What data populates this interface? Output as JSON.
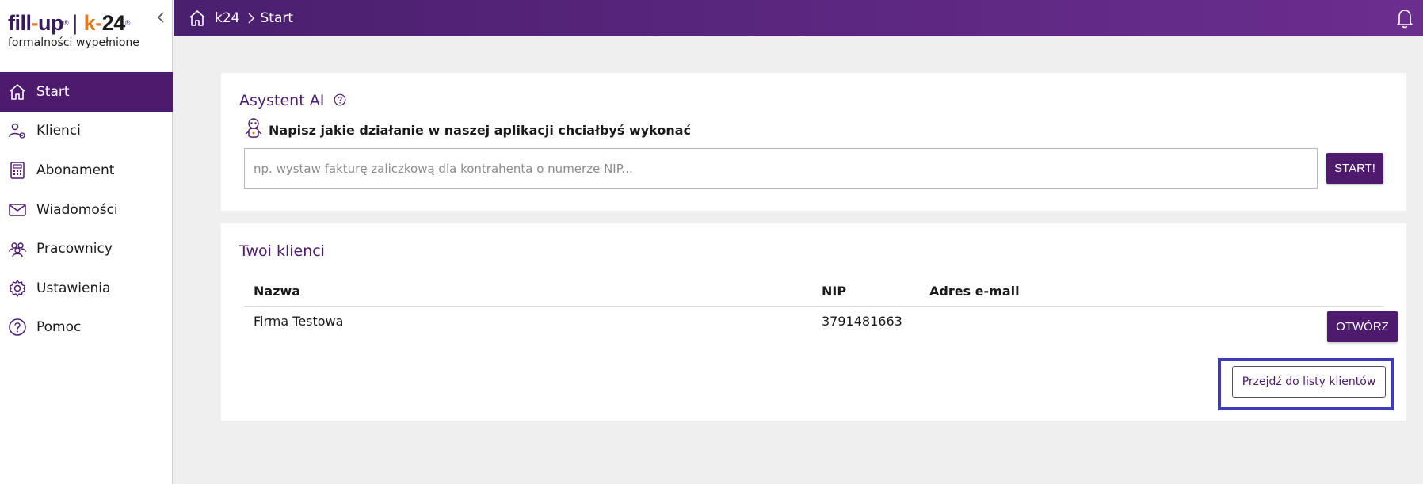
{
  "logo": {
    "fill": "fill",
    "dash1": "-",
    "up": "up",
    "reg1": "®",
    "sep": "|",
    "k": "k",
    "dash2": "-",
    "num": "24",
    "reg2": "®",
    "tagline": "formalności wypełnione"
  },
  "sidebar": {
    "items": [
      {
        "label": "Start",
        "icon": "home-icon",
        "active": true
      },
      {
        "label": "Klienci",
        "icon": "clients-icon"
      },
      {
        "label": "Abonament",
        "icon": "calculator-icon"
      },
      {
        "label": "Wiadomości",
        "icon": "mail-icon"
      },
      {
        "label": "Pracownicy",
        "icon": "team-icon"
      },
      {
        "label": "Ustawienia",
        "icon": "gear-icon"
      },
      {
        "label": "Pomoc",
        "icon": "help-icon"
      }
    ]
  },
  "topbar": {
    "breadcrumb": [
      "k24",
      "Start"
    ]
  },
  "ai": {
    "title": "Asystent AI",
    "prompt": "Napisz jakie działanie w naszej aplikacji chciałbyś wykonać",
    "placeholder": "np. wystaw fakturę zaliczkową dla kontrahenta o numerze NIP...",
    "value": "",
    "start_label": "START!"
  },
  "clients": {
    "title": "Twoi klienci",
    "columns": [
      "Nazwa",
      "NIP",
      "Adres e-mail"
    ],
    "rows": [
      {
        "name": "Firma Testowa",
        "nip": "3791481663",
        "email": "",
        "action": "OTWÓRZ"
      }
    ],
    "list_link_label": "Przejdź do listy klientów"
  },
  "colors": {
    "accent": "#4d1a6e",
    "brand_orange": "#e87722",
    "highlight": "#3d3db8"
  }
}
